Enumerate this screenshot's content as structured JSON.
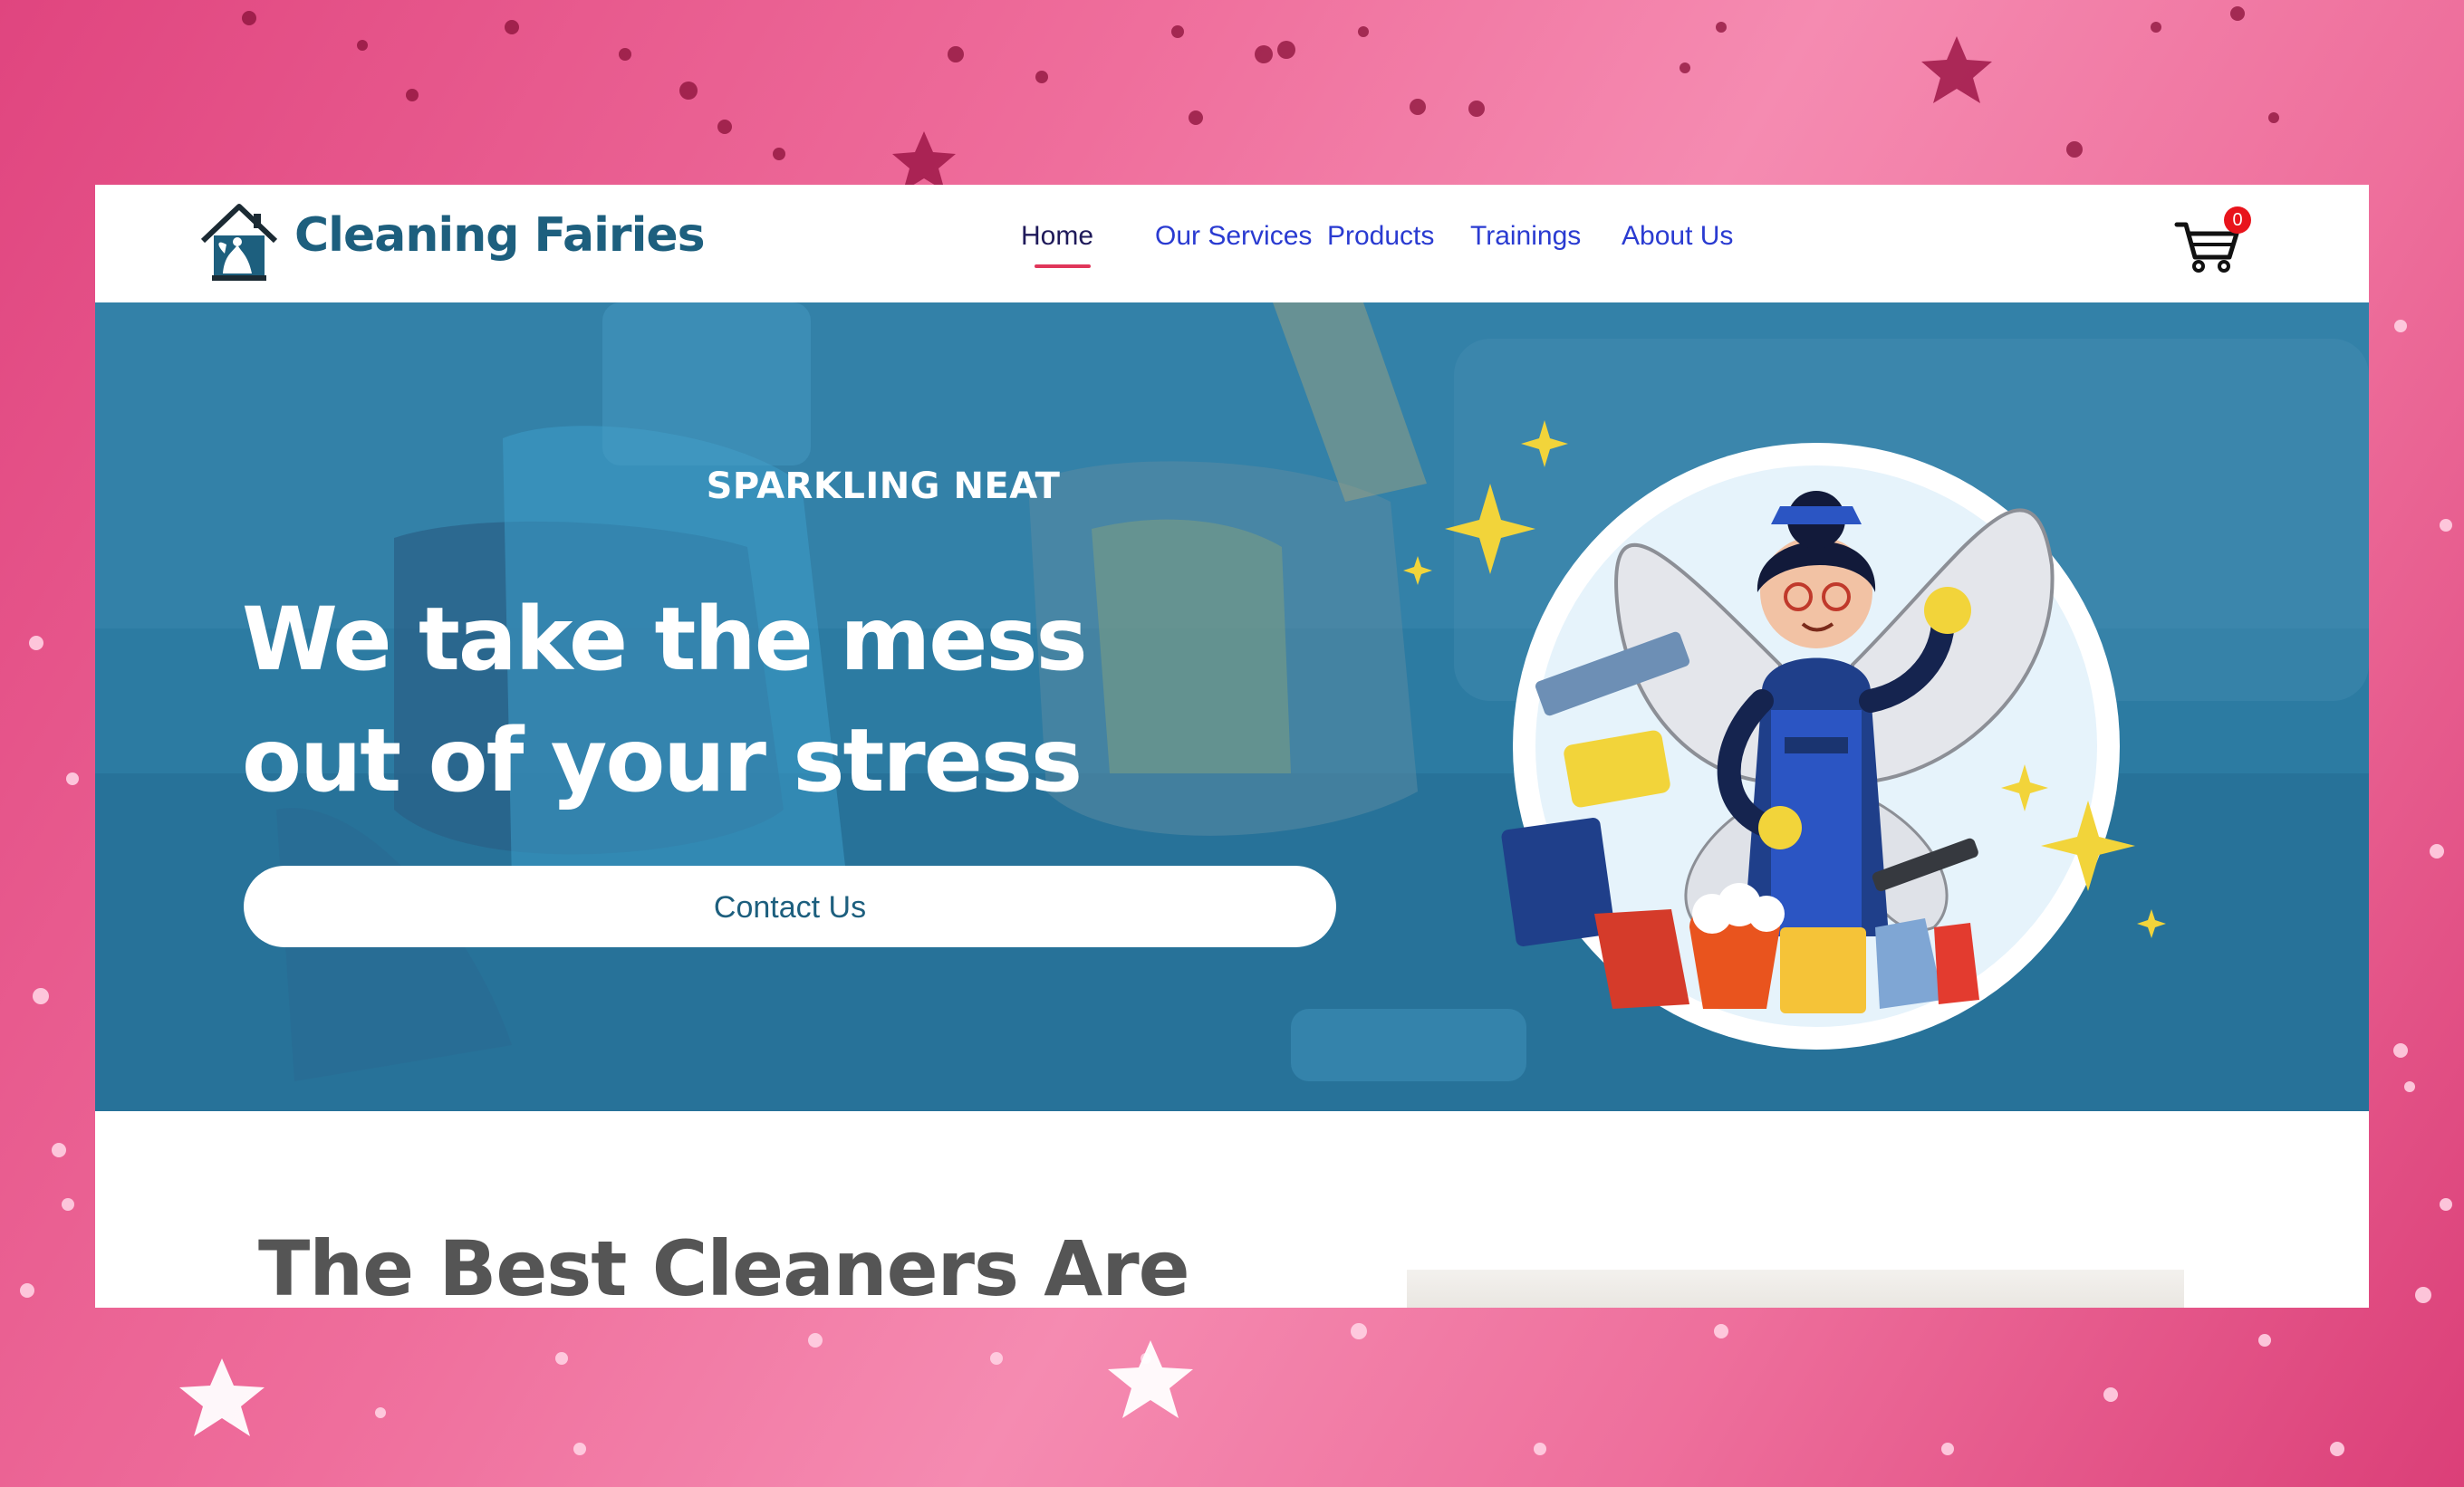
{
  "site": {
    "brand": "Cleaning Fairies",
    "nav": [
      {
        "label": "Home",
        "active": true
      },
      {
        "label": "Our Services",
        "active": false
      },
      {
        "label": "Products",
        "active": false
      },
      {
        "label": "Trainings",
        "active": false
      },
      {
        "label": "About Us",
        "active": false
      }
    ],
    "cart_count": "0"
  },
  "hero": {
    "kicker": "SPARKLING NEAT",
    "title_line1": "We take the mess",
    "title_line2": "out of your stress",
    "cta_label": "Contact Us"
  },
  "section2": {
    "heading": "The Best Cleaners Are"
  },
  "colors": {
    "brand_teal": "#1d5f7e",
    "nav_link": "#2a3bd1",
    "nav_active_underline": "#e0365a",
    "hero_overlay": "#2a7aa1",
    "background_pink": "#ef6e9c",
    "cart_badge": "#e8141c"
  },
  "icons": [
    "house-logo-icon",
    "cart-icon",
    "sparkle-icon",
    "fairy-illustration"
  ]
}
